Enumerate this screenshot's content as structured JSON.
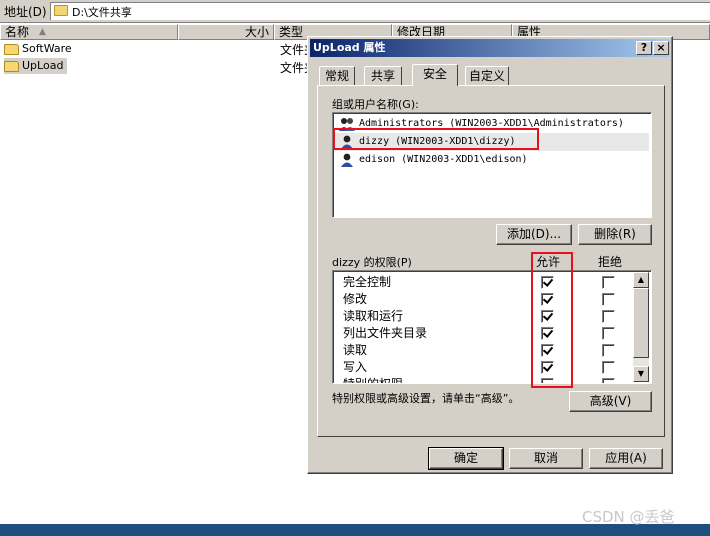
{
  "explorer": {
    "address_label": "地址(D)",
    "address_value": "D:\\文件共享",
    "columns": {
      "name": "名称",
      "size": "大小",
      "type": "类型",
      "modified": "修改日期",
      "attributes": "属性"
    },
    "tree": [
      {
        "label": "SoftWare"
      },
      {
        "label": "UpLoad"
      }
    ],
    "file_types": [
      "文件夹",
      "文件夹"
    ]
  },
  "dialog": {
    "title": "UpLoad 属性",
    "help_button": "?",
    "close_button": "×",
    "tabs": [
      {
        "label": "常规"
      },
      {
        "label": "共享"
      },
      {
        "label": "安全"
      },
      {
        "label": "自定义"
      }
    ],
    "active_tab": "安全",
    "users_label": "组或用户名称(G):",
    "users": [
      {
        "label": "Administrators (WIN2003-XDD1\\Administrators)"
      },
      {
        "label": "dizzy (WIN2003-XDD1\\dizzy)"
      },
      {
        "label": "edison (WIN2003-XDD1\\edison)"
      }
    ],
    "add_button": "添加(D)...",
    "remove_button": "删除(R)",
    "permissions_label": "dizzy 的权限(P)",
    "allow_header": "允许",
    "deny_header": "拒绝",
    "permissions": [
      {
        "name": "完全控制",
        "allow": true,
        "deny": false
      },
      {
        "name": "修改",
        "allow": true,
        "deny": false
      },
      {
        "name": "读取和运行",
        "allow": true,
        "deny": false
      },
      {
        "name": "列出文件夹目录",
        "allow": true,
        "deny": false
      },
      {
        "name": "读取",
        "allow": true,
        "deny": false
      },
      {
        "name": "写入",
        "allow": true,
        "deny": false
      },
      {
        "name": "特别的权限",
        "allow": false,
        "deny": false
      }
    ],
    "advanced_hint": "特别权限或高级设置，请单击“高级”。",
    "advanced_button": "高级(V)",
    "ok_button": "确定",
    "cancel_button": "取消",
    "apply_button": "应用(A)"
  },
  "watermark": "CSDN @丢爸",
  "colors": {
    "highlight": "#e8101a",
    "titlebar": "#0a246a",
    "face": "#d4d0c8"
  }
}
